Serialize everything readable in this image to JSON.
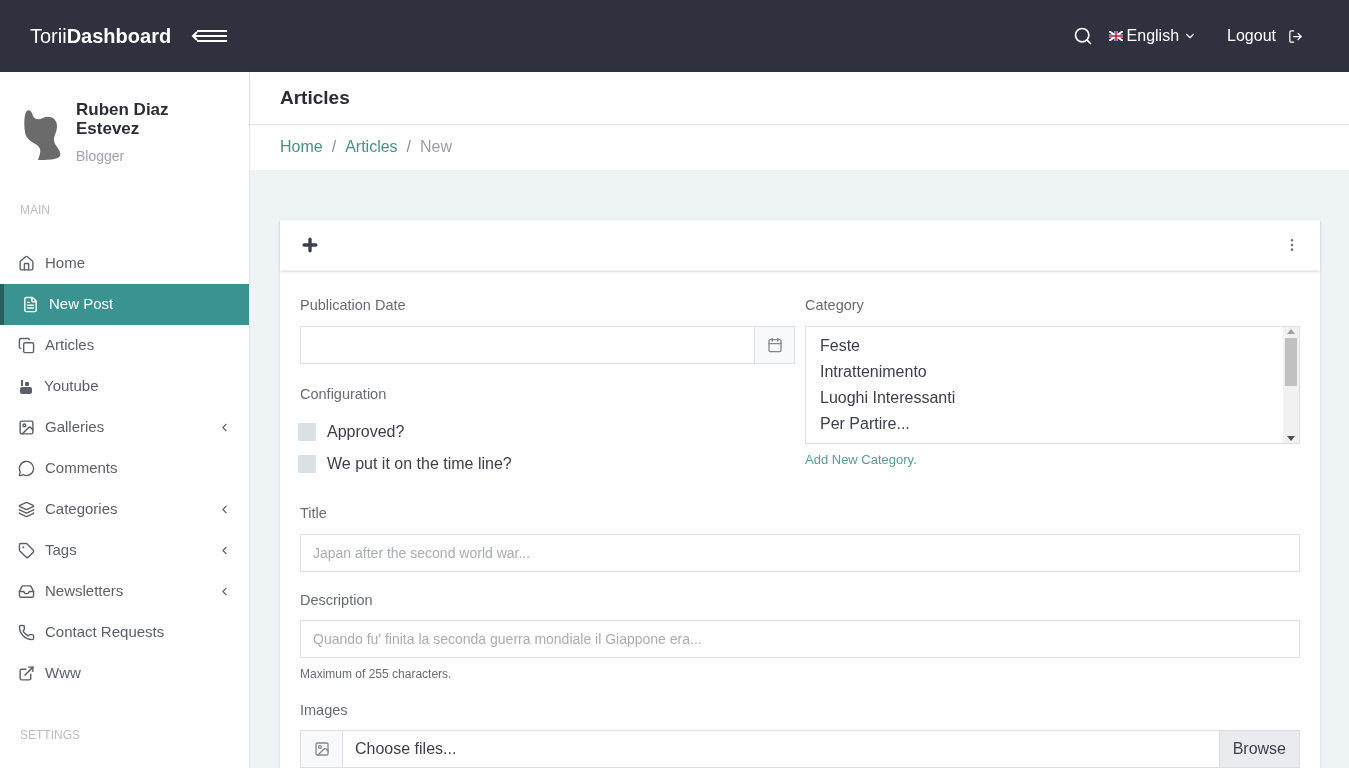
{
  "header": {
    "logo": "Torii**Dashboard**",
    "language": "English",
    "logout": "Logout"
  },
  "sidebar": {
    "user": {
      "name": "Ruben Diaz Estevez",
      "role": "Blogger"
    },
    "sections": [
      {
        "title": "MAIN",
        "items": [
          {
            "label": "Home",
            "selected": false,
            "submenu": false
          },
          {
            "label": "New Post",
            "selected": true,
            "submenu": false
          },
          {
            "label": "Articles",
            "selected": false,
            "submenu": false
          },
          {
            "label": "Youtube",
            "selected": false,
            "submenu": false
          },
          {
            "label": "Galleries",
            "selected": false,
            "submenu": true
          },
          {
            "label": "Comments",
            "selected": false,
            "submenu": false
          },
          {
            "label": "Categories",
            "selected": false,
            "submenu": true
          },
          {
            "label": "Tags",
            "selected": false,
            "submenu": true
          },
          {
            "label": "Newsletters",
            "selected": false,
            "submenu": true
          },
          {
            "label": "Contact Requests",
            "selected": false,
            "submenu": false
          },
          {
            "label": "Www",
            "selected": false,
            "submenu": false
          }
        ]
      },
      {
        "title": "SETTINGS"
      }
    ]
  },
  "page": {
    "title": "Articles",
    "separator": "/",
    "breadcrumb": [
      {
        "label": "Home",
        "link": true
      },
      {
        "label": "Articles",
        "link": true
      },
      {
        "label": "New",
        "link": false
      }
    ]
  },
  "card": {
    "publication_date": {
      "label": "Publication Date"
    },
    "configuration": {
      "label": "Configuration",
      "options": [
        {
          "label": "Approved?",
          "checked": false
        },
        {
          "label": "We put it on the time line?",
          "checked": false
        }
      ]
    },
    "category": {
      "label": "Category",
      "options": [
        {
          "label": "Feste",
          "selected": false
        },
        {
          "label": "Intrattenimento",
          "selected": false
        },
        {
          "label": "Luoghi Interessanti",
          "selected": false
        },
        {
          "label": "Per Partire...",
          "selected": false
        }
      ],
      "add_link": "Add New Category."
    },
    "title": {
      "label": "Title",
      "placeholder": "Japan after the second world war..."
    },
    "description": {
      "label": "Description",
      "placeholder": "Quando fu' finita la seconda guerra mondiale il Giappone era...",
      "help": "Maximum of 255 characters."
    },
    "images": {
      "label": "Images",
      "placeholder": "Choose files...",
      "button": "Browse"
    }
  }
}
